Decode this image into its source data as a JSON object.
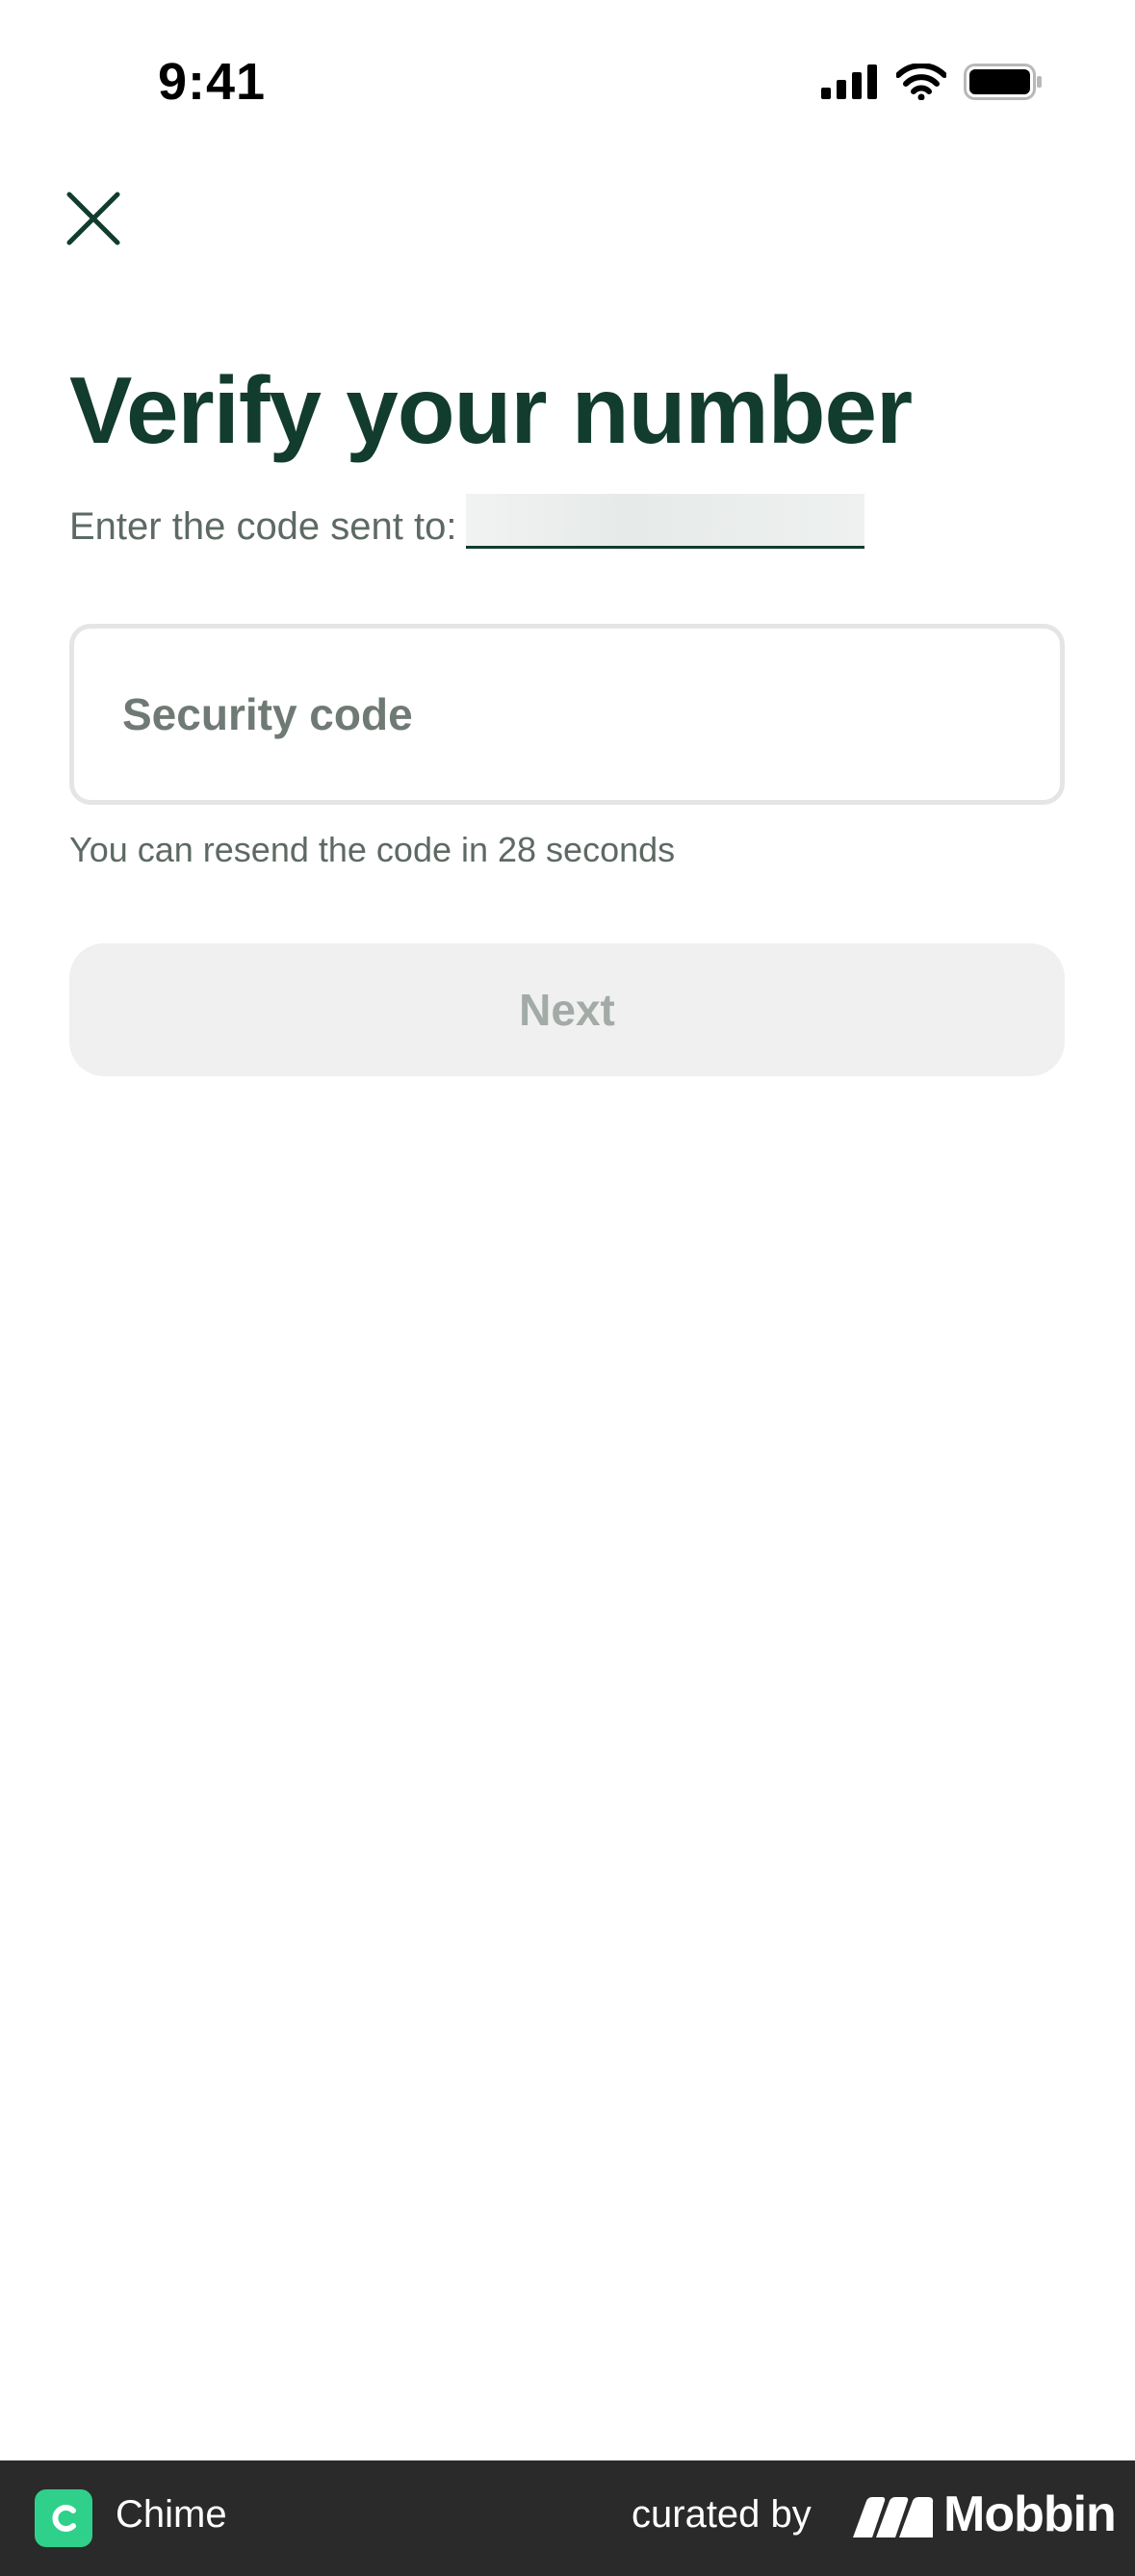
{
  "status_bar": {
    "time": "9:41"
  },
  "header": {
    "title": "Verify your number",
    "subtitle": "Enter the code sent to:"
  },
  "form": {
    "code_placeholder": "Security code",
    "code_value": "",
    "resend_text": "You can resend the code in 28 seconds",
    "next_label": "Next"
  },
  "footer": {
    "app_name": "Chime",
    "curated_label": "curated by",
    "brand_name": "Mobbin"
  },
  "colors": {
    "brand_dark_green": "#123c2d",
    "chime_green": "#2fd08a",
    "disabled_button_bg": "#f0f0f0"
  },
  "icons": [
    "close-icon",
    "cellular-signal-icon",
    "wifi-icon",
    "battery-icon",
    "chime-logo-icon",
    "mobbin-logo-icon"
  ]
}
